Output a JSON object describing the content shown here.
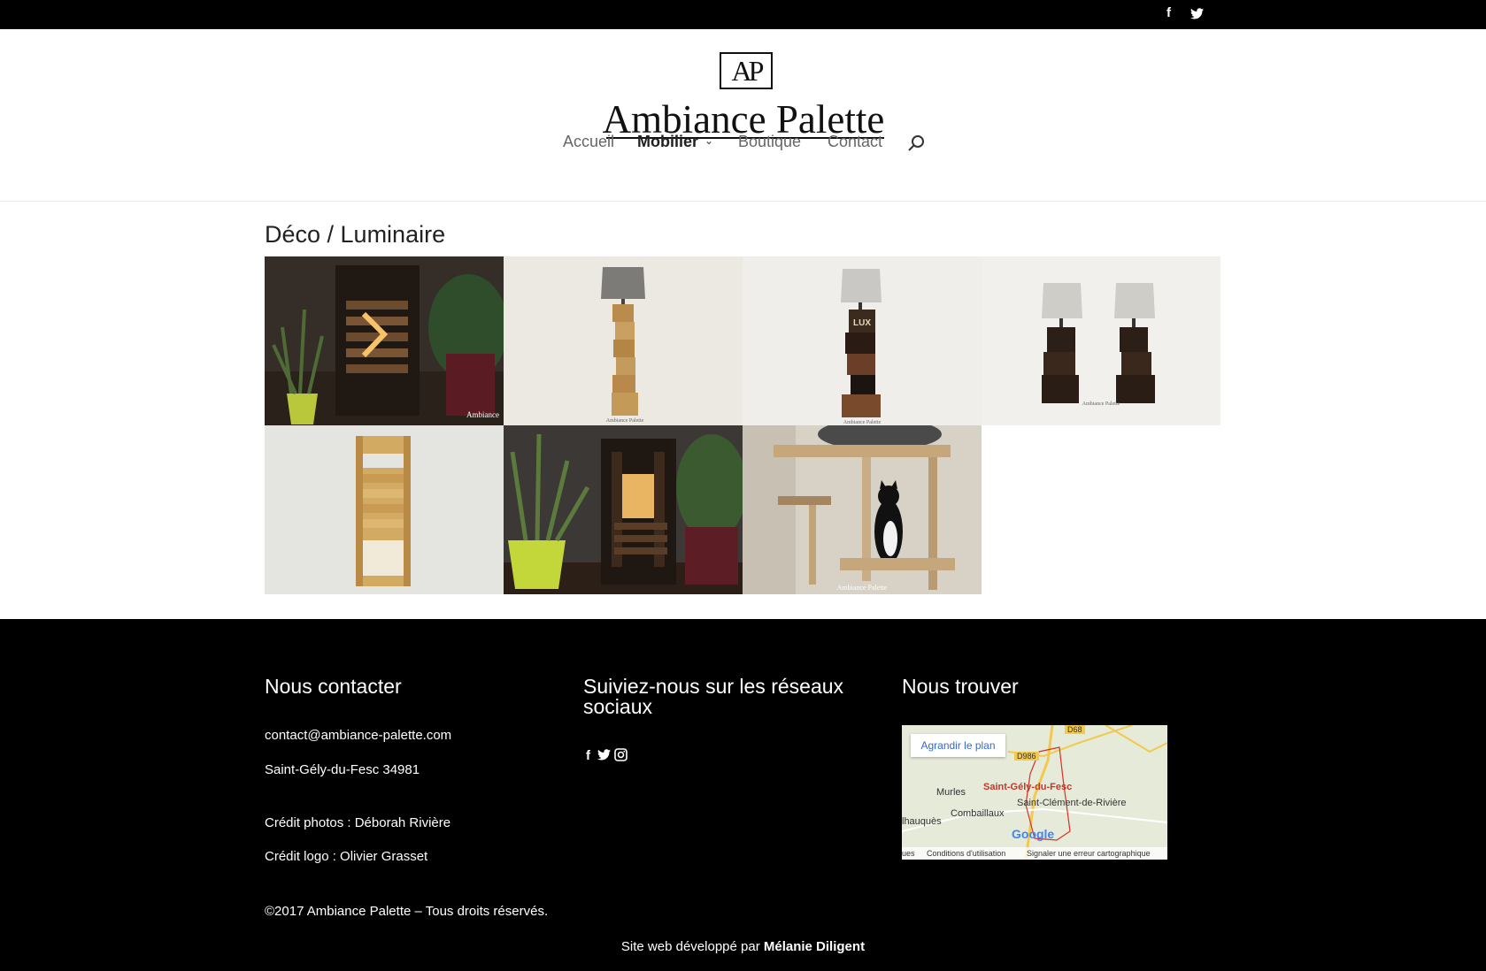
{
  "header": {
    "logo_monogram": "AP",
    "logo_name": "Ambiance Palette",
    "nav": [
      "Accueil",
      "Mobilier",
      "Boutique",
      "Contact"
    ],
    "active_nav": "Mobilier"
  },
  "topbar": {
    "icons": [
      "facebook-icon",
      "twitter-icon"
    ]
  },
  "main": {
    "title": "Déco / Luminaire",
    "gallery_watermark": "Ambiance Palette"
  },
  "footer": {
    "contact": {
      "heading": "Nous contacter",
      "email": "contact@ambiance-palette.com",
      "city": "Saint-Gély-du-Fesc 34981",
      "photo_credit": "Crédit photos : Déborah Rivière",
      "logo_credit": "Crédit logo : Olivier Grasset"
    },
    "social": {
      "heading": "Suiviez-nous sur les réseaux sociaux",
      "icons": [
        "facebook-icon",
        "twitter-icon",
        "instagram-icon"
      ]
    },
    "map": {
      "heading": "Nous trouver",
      "enlarge_button": "Agrandir le plan",
      "labels": [
        "D68",
        "D986",
        "Saint-Gély-du-Fesc",
        "Murles",
        "Saint-Clément-de-Rivière",
        "Combaillaux",
        "lhauquès",
        "Google"
      ],
      "terms": "Conditions d'utilisation",
      "report": "Signaler une erreur cartographique",
      "left_cut": "ues"
    },
    "copyright": "©2017 Ambiance Palette – Tous droits réservés.",
    "credit_prefix": "Site web développé par",
    "credit_name": "Mélanie Diligent"
  },
  "colors": {
    "topbar": "#000000",
    "footer": "#000000",
    "nav_text": "#666666",
    "map_link": "#3367d6"
  }
}
